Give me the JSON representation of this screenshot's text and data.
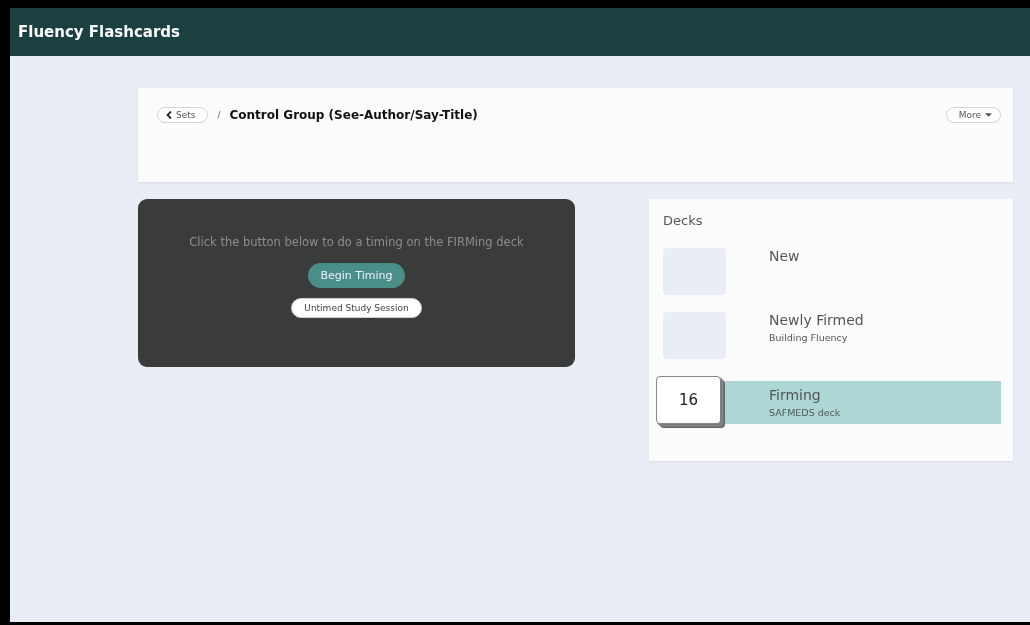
{
  "app_title": "Fluency Flashcards",
  "breadcrumb": {
    "back_label": "Sets",
    "separator": "/",
    "title": "Control Group (See-Author/Say-Title)"
  },
  "more_button": {
    "label": "More"
  },
  "timing_panel": {
    "message": "Click the button below to do a timing on the FIRMing deck",
    "primary_button": "Begin Timing",
    "secondary_button": "Untimed Study Session"
  },
  "decks": {
    "heading": "Decks",
    "items": [
      {
        "name": "New",
        "selected": false
      },
      {
        "name": "Newly Firmed",
        "subtitle": "Building Fluency",
        "selected": false
      },
      {
        "name": "Firming",
        "subtitle": "SAFMEDS deck",
        "count": "16",
        "selected": true
      }
    ]
  }
}
